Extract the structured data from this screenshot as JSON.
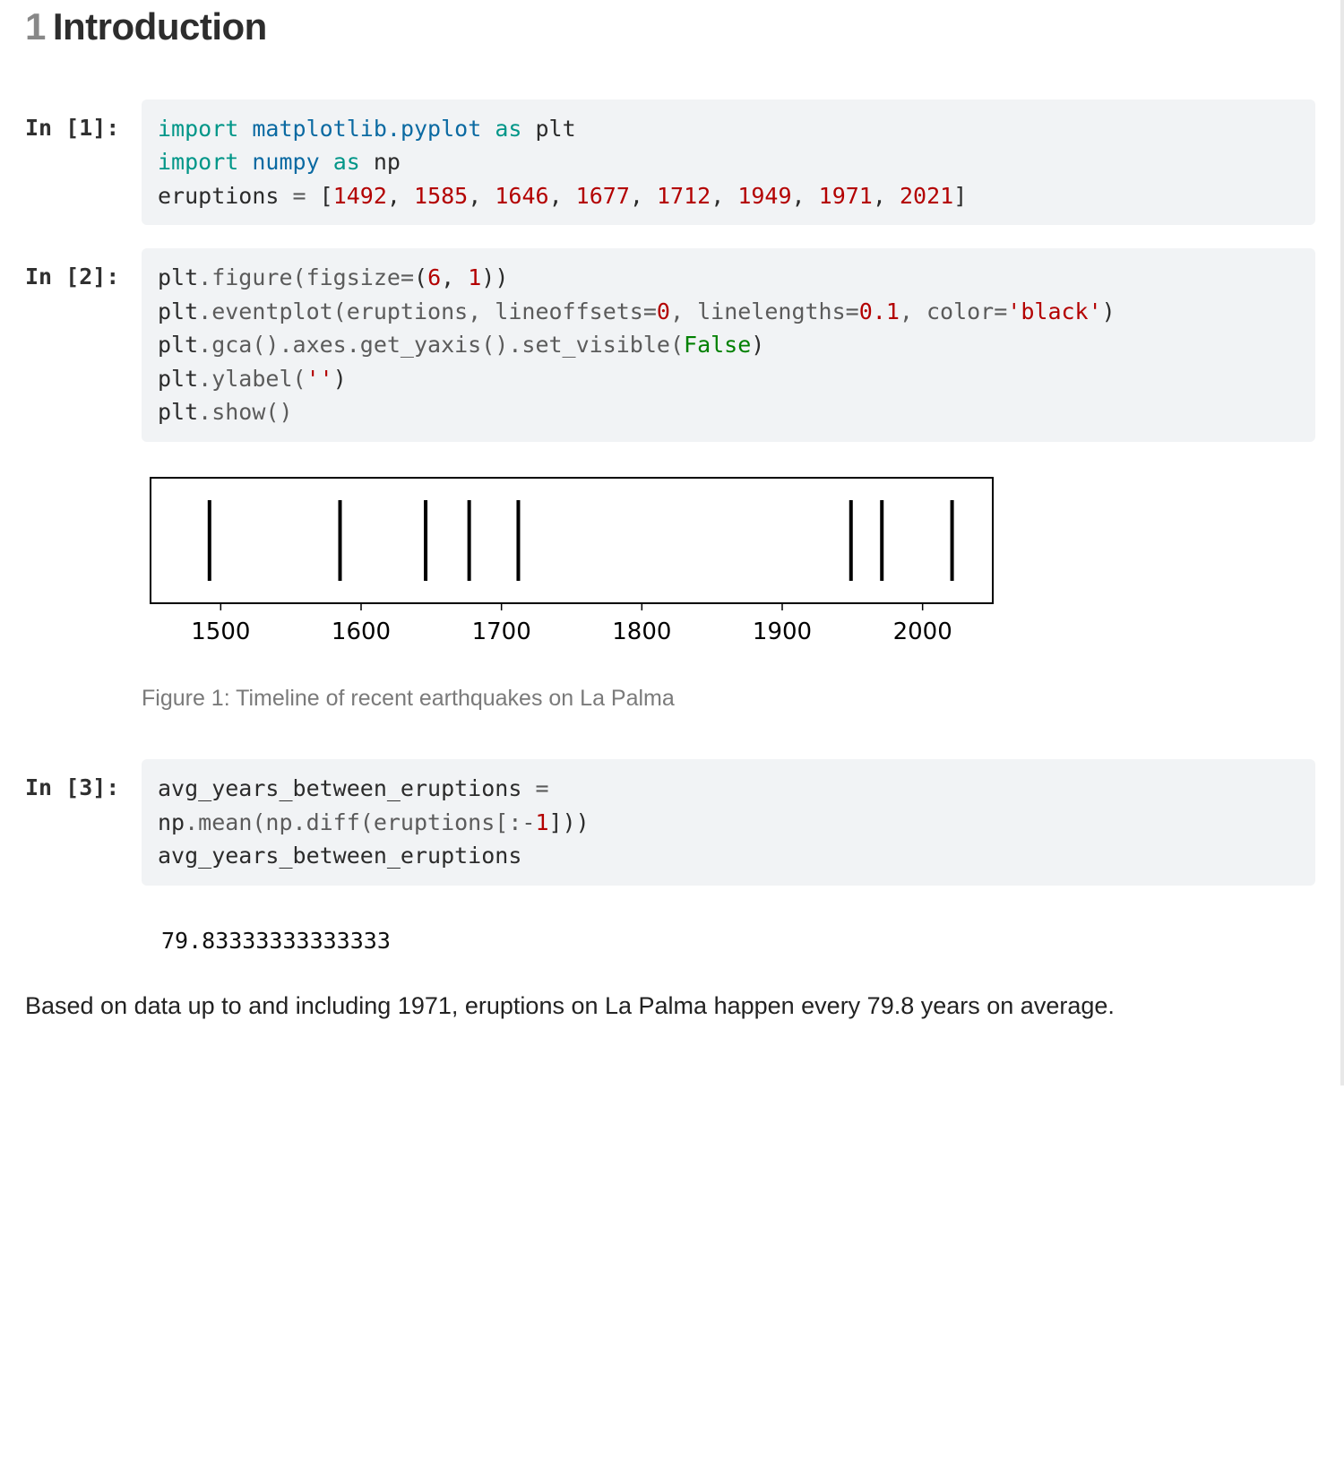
{
  "section": {
    "number": "1",
    "title": "Introduction"
  },
  "cells": {
    "c1_prompt": "In [1]:",
    "c2_prompt": "In [2]:",
    "c3_prompt": "In [3]:"
  },
  "code1": {
    "l1_kw1": "import",
    "l1_nm": "matplotlib.pyplot",
    "l1_kw2": "as",
    "l1_al": "plt",
    "l2_kw1": "import",
    "l2_nm": "numpy",
    "l2_kw2": "as",
    "l2_al": "np",
    "l3_var": "eruptions",
    "l3_eq": " = ",
    "l3_open": "[",
    "n0": "1492",
    "n1": "1585",
    "n2": "1646",
    "n3": "1677",
    "n4": "1712",
    "n5": "1949",
    "n6": "1971",
    "n7": "2021",
    "l3_close": "]"
  },
  "code2": {
    "l1a": "plt",
    "l1b": ".figure(figsize",
    "l1c": "=",
    "l1d": "(",
    "l1n1": "6",
    "l1sep": ", ",
    "l1n2": "1",
    "l1e": "))",
    "l2a": "plt",
    "l2b": ".eventplot(eruptions, lineoffsets",
    "l2c": "=",
    "l2n1": "0",
    "l2d": ", linelengths",
    "l2e": "=",
    "l2n2": "0.1",
    "l2f": ", color",
    "l2g": "=",
    "l2str": "'black'",
    "l2h": ")",
    "l3a": "plt",
    "l3b": ".gca().axes.get_yaxis().set_visible(",
    "l3c": "False",
    "l3d": ")",
    "l4a": "plt",
    "l4b": ".ylabel(",
    "l4str": "''",
    "l4c": ")",
    "l5a": "plt",
    "l5b": ".show()"
  },
  "code3": {
    "l1a": "avg_years_between_eruptions ",
    "l1b": "=",
    "l2a": "np",
    "l2b": ".mean(np.diff(eruptions[:",
    "l2c": "-",
    "l2n": "1",
    "l2d": "]))",
    "l3a": "avg_years_between_eruptions"
  },
  "output3": "79.83333333333333",
  "figure": {
    "caption": "Figure 1: Timeline of recent earthquakes on La Palma",
    "ticks": {
      "t0": "1500",
      "t1": "1600",
      "t2": "1700",
      "t3": "1800",
      "t4": "1900",
      "t5": "2000"
    }
  },
  "chart_data": {
    "type": "eventplot",
    "title": "Timeline of recent earthquakes on La Palma",
    "xlabel": "",
    "ylabel": "",
    "x_range": [
      1450,
      2050
    ],
    "x_ticks": [
      1500,
      1600,
      1700,
      1800,
      1900,
      2000
    ],
    "events": [
      1492,
      1585,
      1646,
      1677,
      1712,
      1949,
      1971,
      2021
    ]
  },
  "prose": "Based on data up to and including 1971, eruptions on La Palma happen every 79.8 years on average."
}
